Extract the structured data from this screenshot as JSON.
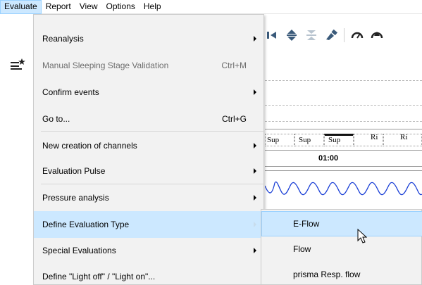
{
  "menubar": {
    "items": [
      "Evaluate",
      "Report",
      "View",
      "Options",
      "Help"
    ]
  },
  "evaluate_menu": {
    "items": [
      {
        "label": "Reanalysis",
        "shortcut": "",
        "submenu": true,
        "disabled": false
      },
      {
        "label": "Manual Sleeping Stage Validation",
        "shortcut": "Ctrl+M",
        "submenu": false,
        "disabled": true
      },
      {
        "label": "Confirm events",
        "shortcut": "",
        "submenu": true,
        "disabled": false
      },
      {
        "label": "Go to...",
        "shortcut": "Ctrl+G",
        "submenu": false,
        "disabled": false
      },
      {
        "label": "New creation of channels",
        "shortcut": "",
        "submenu": true,
        "disabled": false
      },
      {
        "label": "Evaluation Pulse",
        "shortcut": "",
        "submenu": true,
        "disabled": false
      },
      {
        "label": "Pressure analysis",
        "shortcut": "",
        "submenu": true,
        "disabled": false
      },
      {
        "label": "Define Evaluation Type",
        "shortcut": "",
        "submenu": true,
        "disabled": false
      },
      {
        "label": "Special Evaluations",
        "shortcut": "",
        "submenu": true,
        "disabled": false
      },
      {
        "label": "Define \"Light off\" / \"Light on\"...",
        "shortcut": "",
        "submenu": false,
        "disabled": false
      }
    ]
  },
  "evaluation_type_submenu": {
    "items": [
      "E-Flow",
      "Flow",
      "prisma Resp. flow"
    ]
  },
  "background": {
    "stage_labels": [
      "Sup",
      "Sup",
      "Sup",
      "Ri",
      "Ri"
    ],
    "time_label": "01:00"
  },
  "colors": {
    "highlight": "#cce8ff",
    "highlight_border": "#99d1ff",
    "menu_bg": "#f2f2f2",
    "wave": "#1a3fd6",
    "disabled_text": "#6d6d6d"
  }
}
